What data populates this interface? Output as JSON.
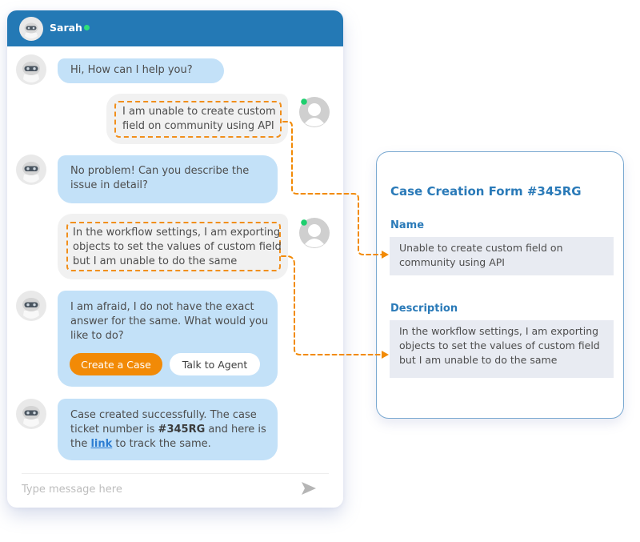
{
  "header": {
    "agent_name": "Sarah",
    "status": "online",
    "status_color": "#2ee07a",
    "bg_color": "#2479b5"
  },
  "messages": [
    {
      "sender": "bot",
      "text": "Hi, How can I help you?"
    },
    {
      "sender": "user",
      "text": "I am unable to create custom field on community using API",
      "highlighted": true
    },
    {
      "sender": "bot",
      "text": "No problem! Can you describe the issue in detail?"
    },
    {
      "sender": "user",
      "text": "In the workflow settings, I am exporting objects to set the values of custom field but I am unable to do the same",
      "highlighted": true
    },
    {
      "sender": "bot",
      "text": "I am afraid, I do not have the exact answer for the same. What would you like to do?",
      "actions": [
        "Create a Case",
        "Talk to Agent"
      ]
    },
    {
      "sender": "bot",
      "text_before": "Case created successfully. The case ticket number is ",
      "ticket": "#345RG",
      "text_middle": " and here is the ",
      "link_text": "link",
      "text_after": " to track the same."
    }
  ],
  "composer": {
    "placeholder": "Type message here",
    "send_icon": "send-icon"
  },
  "form": {
    "title": "Case Creation Form #345RG",
    "fields": [
      {
        "label": "Name",
        "value": "Unable to create custom field on community using API"
      },
      {
        "label": "Description",
        "value": "In the workflow settings, I am exporting objects to set the values of custom field but I am unable to do the same"
      }
    ]
  },
  "colors": {
    "accent_orange": "#f28a06",
    "bot_bubble": "#c3e1f8",
    "user_bubble": "#f1f1f1",
    "form_accent": "#2a7ab8",
    "field_bg": "#e8ebf2"
  }
}
